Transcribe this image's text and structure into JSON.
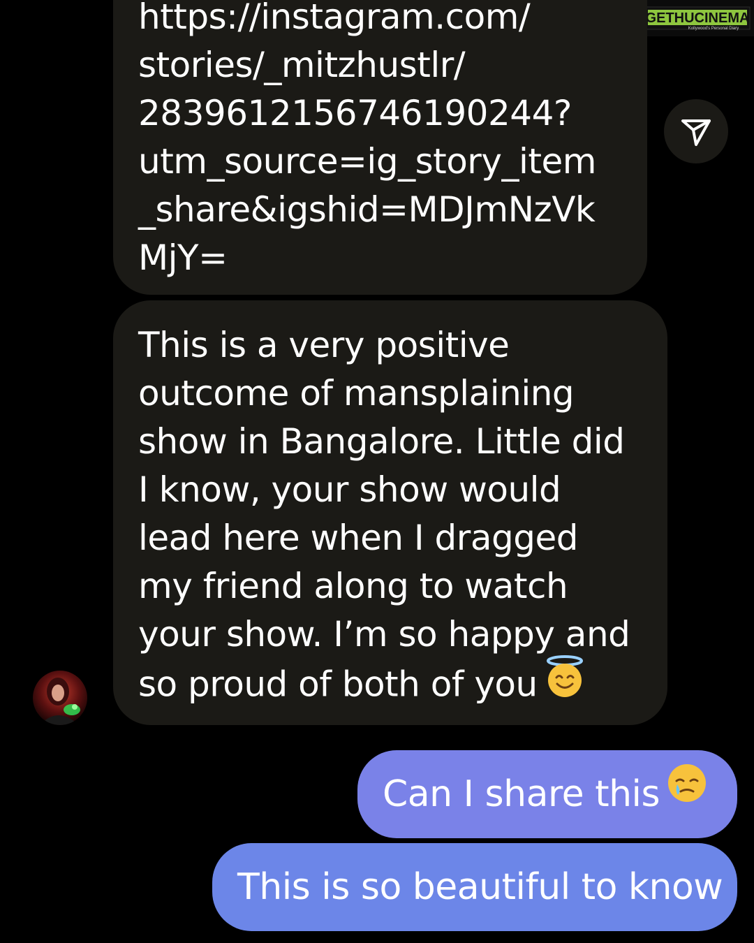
{
  "watermark": {
    "brand": "GETHUCINEMA",
    "tagline": "Kollywood's Personal Diary"
  },
  "messages": [
    {
      "sender": "other",
      "type": "link",
      "lines": [
        "https://instagram.com/",
        "stories/_mitzhustlr/",
        "2839612156746190244?",
        "utm_source=ig_story_item",
        "_share&igshid=MDJmNzVk",
        "MjY="
      ]
    },
    {
      "sender": "other",
      "type": "text",
      "lines": [
        "This is a very positive",
        "outcome of mansplaining",
        "show in Bangalore. Little did",
        "I know, your show would",
        "lead here when I dragged",
        "my friend along to watch",
        "your show. I’m so happy and",
        "so proud of both of you"
      ],
      "emoji": "smiling-face-with-halo"
    },
    {
      "sender": "me",
      "text": "Can I share this",
      "emoji": "face-holding-back-tears",
      "color": "#7a82e8"
    },
    {
      "sender": "me",
      "text": "This is so beautiful to know",
      "color": "#6c86e8"
    }
  ],
  "icons": {
    "share": "paper-plane-icon",
    "avatar": "profile-avatar"
  },
  "colors": {
    "background": "#000000",
    "incoming_bubble": "#1b1a16",
    "outgoing_bubble_1": "#7a82e8",
    "outgoing_bubble_2": "#6c86e8"
  }
}
